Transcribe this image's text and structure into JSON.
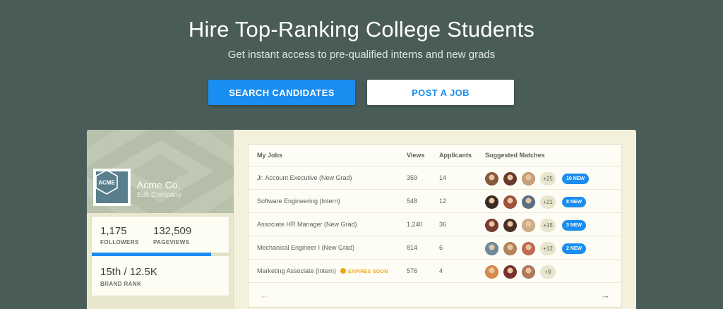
{
  "hero": {
    "title": "Hire Top-Ranking College Students",
    "subtitle": "Get instant access to pre-qualified interns and new grads",
    "primary_cta": "SEARCH CANDIDATES",
    "secondary_cta": "POST A JOB"
  },
  "company": {
    "logo_text": "ACME",
    "name": "Acme Co.",
    "edit_label": "Edit Company",
    "followers": "1,175",
    "followers_label": "FOLLOWERS",
    "pageviews": "132,509",
    "pageviews_label": "PAGEVIEWS",
    "rank": "15th / 12.5K",
    "rank_label": "BRAND RANK",
    "progress_fraction": 0.86
  },
  "jobs": {
    "headers": [
      "My Jobs",
      "Views",
      "Applicants",
      "Suggested Matches"
    ],
    "expires_label": "EXPIRES SOON",
    "rows": [
      {
        "title": "Jr. Account Executive (New Grad)",
        "views": "359",
        "applicants": "14",
        "more": "+25",
        "new": "10 NEW",
        "expires": false,
        "avatars": [
          "#8a5a3c",
          "#6b3a2a",
          "#c9a079"
        ]
      },
      {
        "title": "Software Engineering (Intern)",
        "views": "548",
        "applicants": "12",
        "more": "+21",
        "new": "8 NEW",
        "expires": false,
        "avatars": [
          "#3a2a22",
          "#a0523a",
          "#5b6f86"
        ]
      },
      {
        "title": "Associate HR Manager (New Grad)",
        "views": "1,240",
        "applicants": "36",
        "more": "+15",
        "new": "3 NEW",
        "expires": false,
        "avatars": [
          "#7a3a30",
          "#4a2f28",
          "#d0ad86"
        ]
      },
      {
        "title": "Mechanical Engineer I (New Grad)",
        "views": "814",
        "applicants": "6",
        "more": "+12",
        "new": "2 NEW",
        "expires": false,
        "avatars": [
          "#6f8a9c",
          "#b6845a",
          "#c26a55"
        ]
      },
      {
        "title": "Marketing Associate (Intern)",
        "views": "576",
        "applicants": "4",
        "more": "+9",
        "new": "",
        "expires": true,
        "avatars": [
          "#d98a4a",
          "#7a2f2f",
          "#b07a5a"
        ]
      }
    ],
    "prev_icon": "←",
    "next_icon": "→"
  },
  "colors": {
    "background": "#4a5c57",
    "accent": "#1a8df0",
    "warning": "#f0a614"
  }
}
